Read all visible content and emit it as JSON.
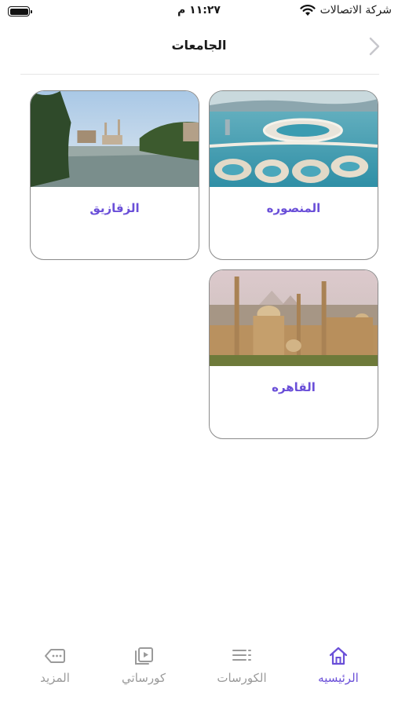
{
  "status_bar": {
    "time": "١١:٢٧ م",
    "carrier": "شركة الاتصالات"
  },
  "header": {
    "title": "الجامعات"
  },
  "universities": [
    {
      "name": "المنصوره",
      "image": "coastal-development-aerial"
    },
    {
      "name": "الزقازيق",
      "image": "river-mosque-landscape"
    },
    {
      "name": "القاهره",
      "image": "cairo-mosques-skyline"
    }
  ],
  "tab_bar": {
    "tabs": [
      {
        "label": "الرئيسيه",
        "icon": "home-icon",
        "active": true
      },
      {
        "label": "الكورسات",
        "icon": "list-icon",
        "active": false
      },
      {
        "label": "كورساتي",
        "icon": "video-library-icon",
        "active": false
      },
      {
        "label": "المزيد",
        "icon": "more-tag-icon",
        "active": false
      }
    ]
  },
  "colors": {
    "accent": "#6a4fd8",
    "inactive": "#9a9a9a",
    "card_border": "#8a8a8a"
  }
}
